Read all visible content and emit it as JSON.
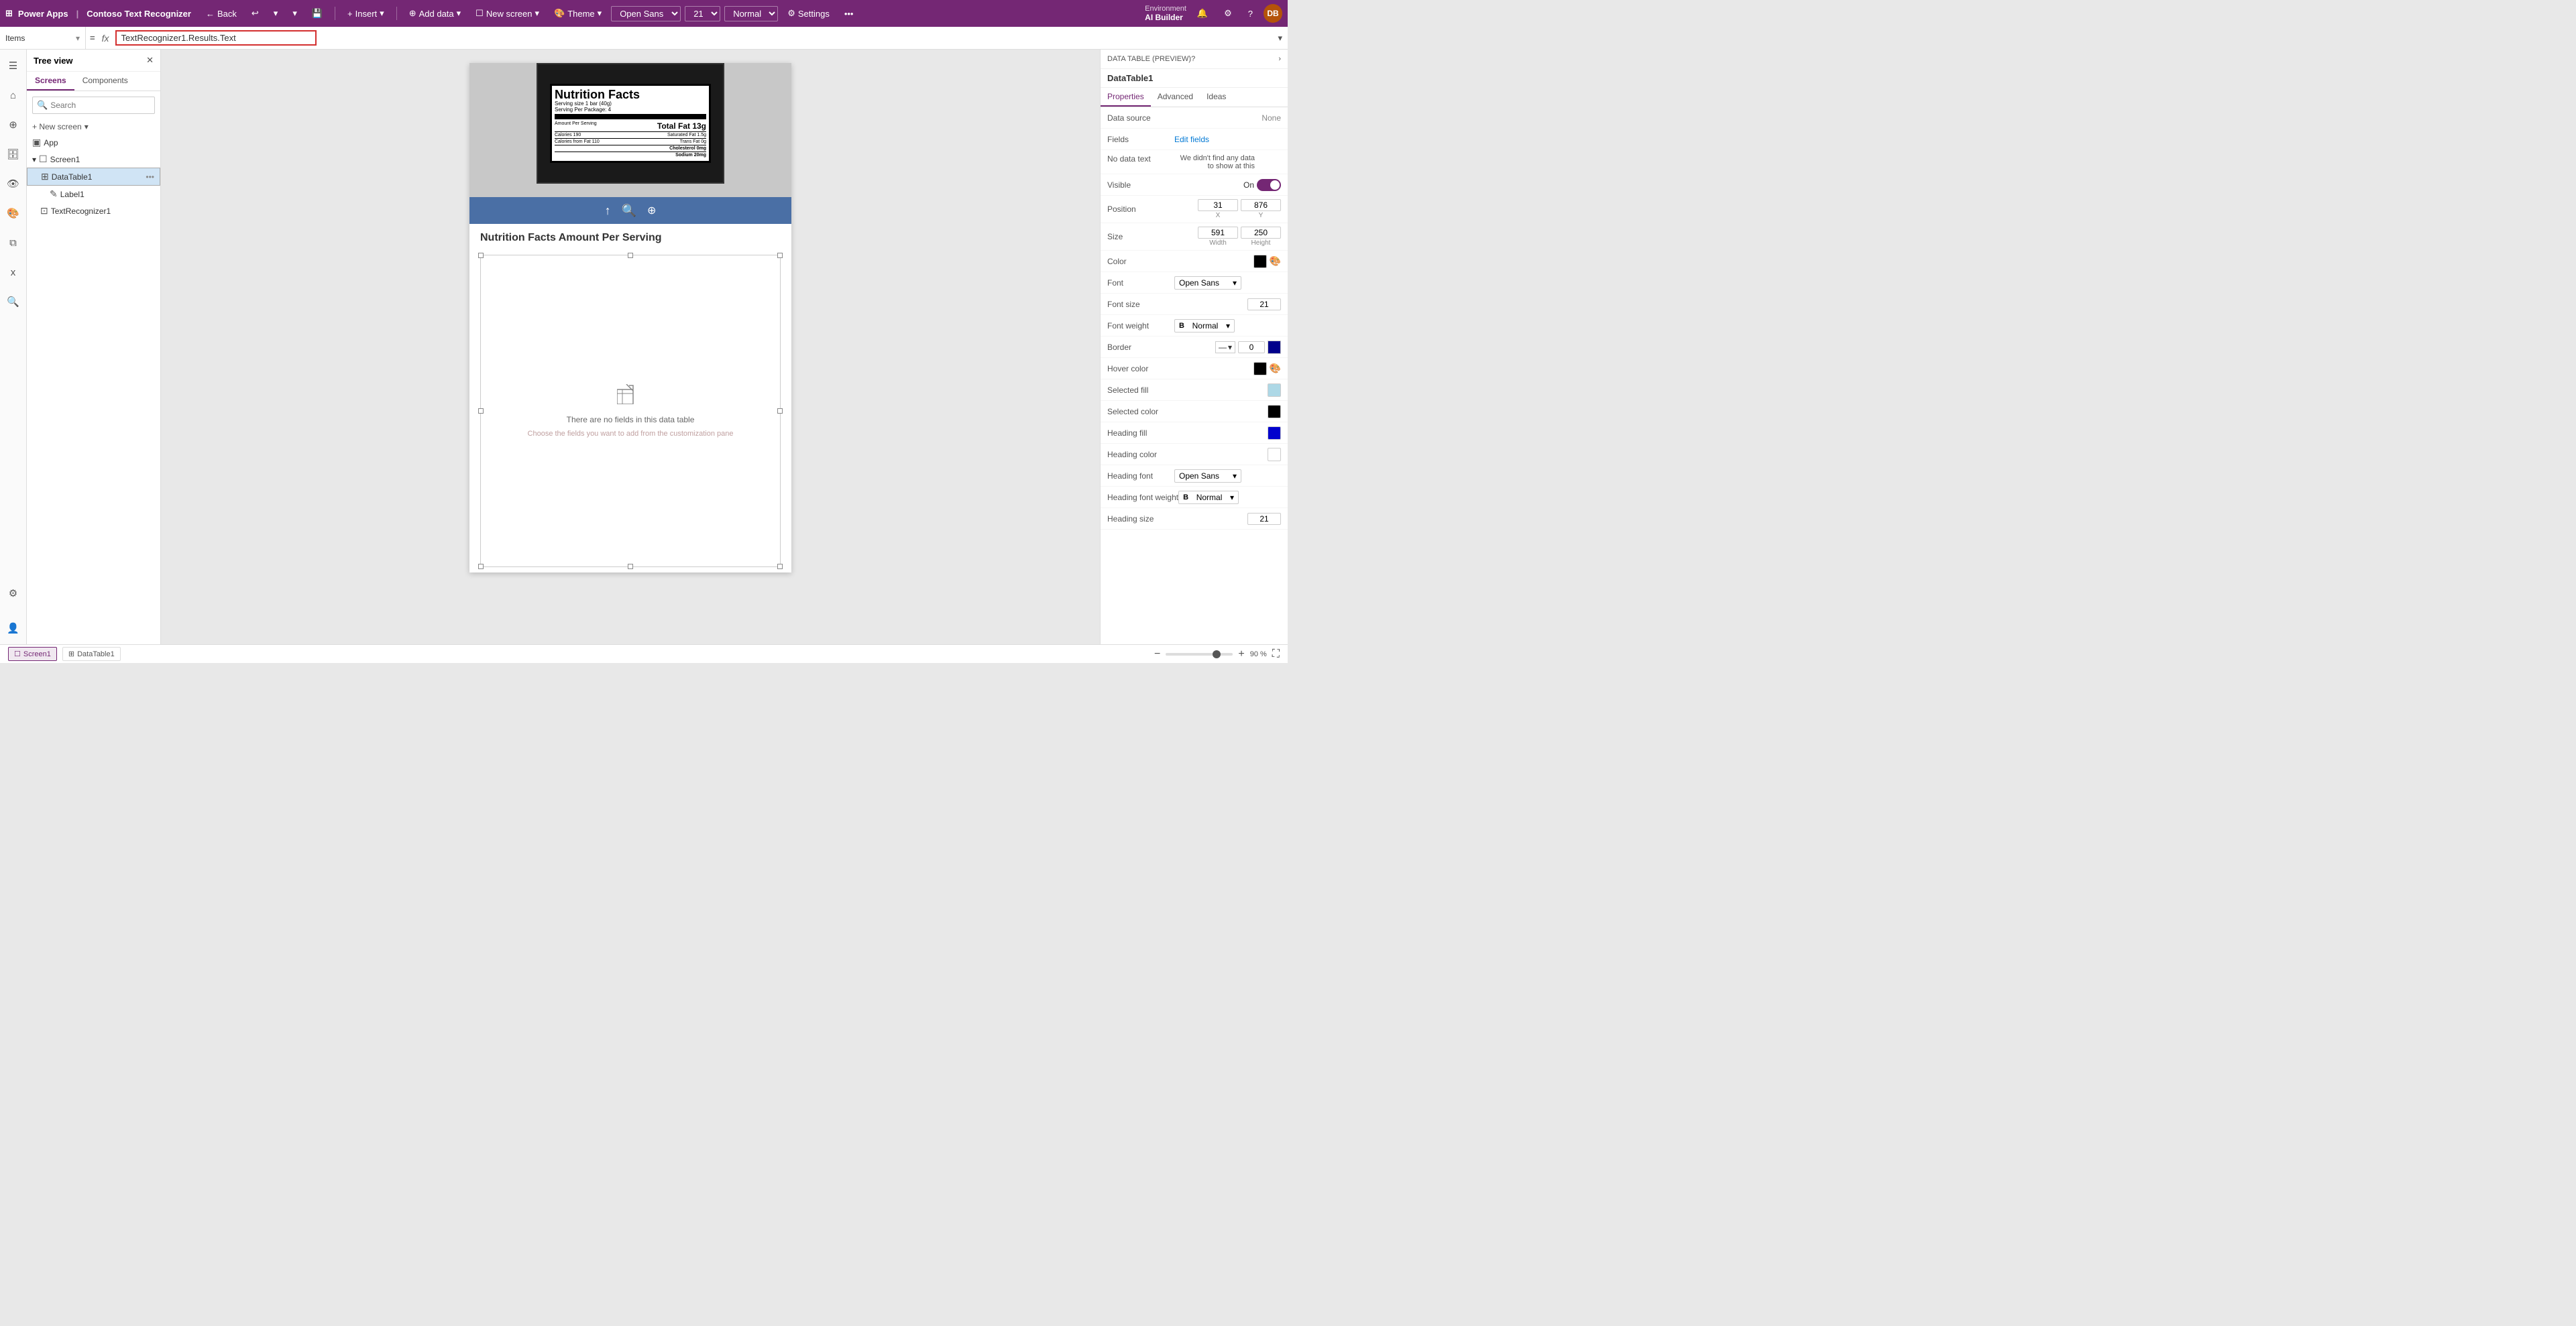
{
  "topbar": {
    "product": "Power Apps",
    "separator": "|",
    "app_name": "Contoso Text Recognizer",
    "back_label": "Back",
    "insert_label": "Insert",
    "add_data_label": "Add data",
    "new_screen_label": "New screen",
    "theme_label": "Theme",
    "font_label": "Open Sans",
    "font_size": "21",
    "font_weight": "Normal",
    "settings_label": "Settings",
    "env_label": "Environment",
    "env_name": "AI Builder"
  },
  "formula_bar": {
    "scope": "Items",
    "equals": "=",
    "fx": "fx",
    "formula": "TextRecognizer1.Results.Text"
  },
  "tree_view": {
    "title": "Tree view",
    "tabs": [
      "Screens",
      "Components"
    ],
    "active_tab": "Screens",
    "search_placeholder": "Search",
    "new_screen_label": "+ New screen",
    "items": [
      {
        "label": "App",
        "icon": "▣",
        "indent": 0,
        "type": "app"
      },
      {
        "label": "Screen1",
        "icon": "▢",
        "indent": 0,
        "type": "screen",
        "expanded": true
      },
      {
        "label": "DataTable1",
        "icon": "⊞",
        "indent": 1,
        "type": "datatable",
        "selected": true
      },
      {
        "label": "Label1",
        "icon": "✎",
        "indent": 2,
        "type": "label"
      },
      {
        "label": "TextRecognizer1",
        "icon": "⊡",
        "indent": 1,
        "type": "ai"
      }
    ]
  },
  "canvas": {
    "heading": "Nutrition Facts Amount Per Serving",
    "empty_table_text": "There are no fields in this data table",
    "empty_table_sub": "Choose the fields you want to add from the customization pane"
  },
  "properties_panel": {
    "header": "DATA TABLE (PREVIEW)",
    "component_name": "DataTable1",
    "tabs": [
      "Properties",
      "Advanced",
      "Ideas"
    ],
    "active_tab": "Properties",
    "props": [
      {
        "label": "Data source",
        "value": "None",
        "type": "text"
      },
      {
        "label": "Fields",
        "value": "Edit fields",
        "type": "link"
      },
      {
        "label": "No data text",
        "value": "We didn't find any data to show at this",
        "type": "text"
      },
      {
        "label": "Visible",
        "value": "On",
        "type": "toggle",
        "on": true
      },
      {
        "label": "Position",
        "x": "31",
        "y": "876",
        "type": "xy"
      },
      {
        "label": "Size",
        "width": "591",
        "height": "250",
        "type": "wh"
      },
      {
        "label": "Color",
        "type": "color",
        "color": "#000000"
      },
      {
        "label": "Font",
        "value": "Open Sans",
        "type": "dropdown"
      },
      {
        "label": "Font size",
        "value": "21",
        "type": "number"
      },
      {
        "label": "Font weight",
        "value": "Normal",
        "type": "dropdown"
      },
      {
        "label": "Border",
        "value": "0",
        "type": "border",
        "borderColor": "#00008b"
      },
      {
        "label": "Hover color",
        "type": "color",
        "color": "#000000"
      },
      {
        "label": "Selected fill",
        "type": "color",
        "color": "#add8e6"
      },
      {
        "label": "Selected color",
        "type": "color",
        "color": "#000000"
      },
      {
        "label": "Heading fill",
        "type": "color",
        "color": "#0000cd"
      },
      {
        "label": "Heading color",
        "type": "color",
        "color": "#ffffff"
      },
      {
        "label": "Heading font",
        "value": "Open Sans",
        "type": "dropdown"
      },
      {
        "label": "Heading font weight",
        "value": "Normal",
        "type": "dropdown"
      },
      {
        "label": "Heading size",
        "value": "21",
        "type": "number"
      }
    ]
  },
  "status_bar": {
    "screen1_label": "Screen1",
    "datatable1_label": "DataTable1",
    "zoom_minus": "−",
    "zoom_value": "90 %",
    "zoom_plus": "+",
    "fullscreen_icon": "⛶"
  },
  "icons": {
    "grid": "⊞",
    "back_arrow": "←",
    "undo": "↩",
    "redo": "↪",
    "save": "💾",
    "chevron_down": "▾",
    "plus": "+",
    "settings": "⚙",
    "question": "?",
    "user": "👤",
    "bell": "🔔",
    "search": "🔍",
    "close": "✕",
    "tree_arrow": "▾",
    "more": "•••",
    "expand": "⌄",
    "upload": "↑",
    "zoom_in": "🔍+",
    "zoom_out": "🔍−",
    "checklist": "☰",
    "monitor": "🖥"
  }
}
